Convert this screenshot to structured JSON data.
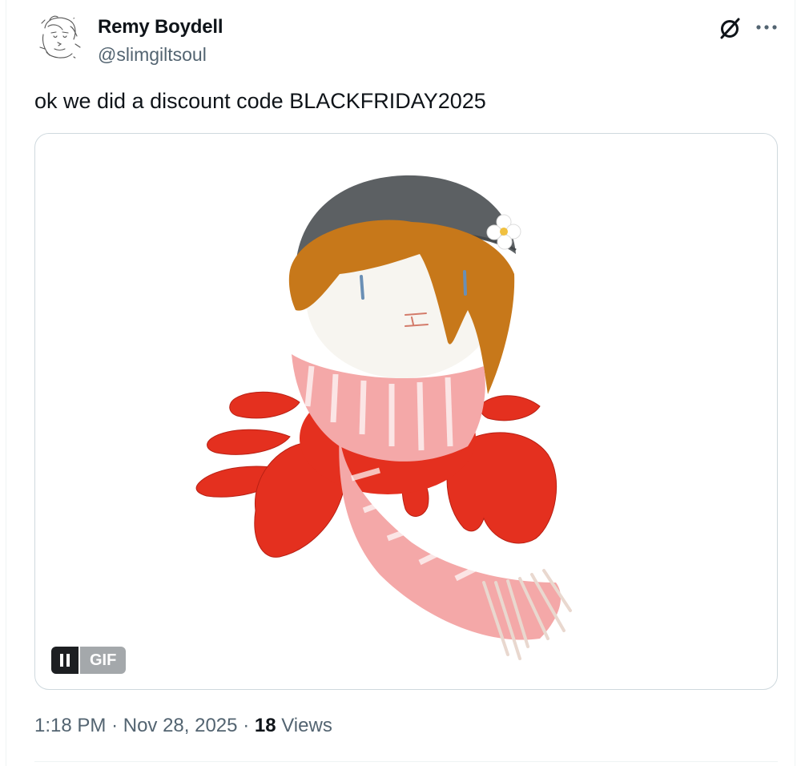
{
  "author": {
    "display_name": "Remy Boydell",
    "handle": "@slimgiltsoul",
    "avatar_icon": "sketch-avatar"
  },
  "header_actions": {
    "grok_icon": "grok-slash-circle-icon",
    "more_icon": "more-dots-icon"
  },
  "post": {
    "text": "ok we did a discount code BLACKFRIDAY2025"
  },
  "media": {
    "type": "gif",
    "subject_icon": "crab-plush-with-scarf",
    "badge_label": "GIF",
    "pause_icon": "pause-icon"
  },
  "meta": {
    "time": "1:18 PM",
    "separator": "·",
    "date": "Nov 28, 2025",
    "views_count": "18",
    "views_label": "Views"
  },
  "colors": {
    "text_primary": "#0f1419",
    "text_secondary": "#536471",
    "border": "#cfd9de",
    "crab_red": "#e4301f",
    "hat_grey": "#5c6063",
    "hair_orange": "#c7781a",
    "scarf_pink": "#f4a8a8"
  }
}
